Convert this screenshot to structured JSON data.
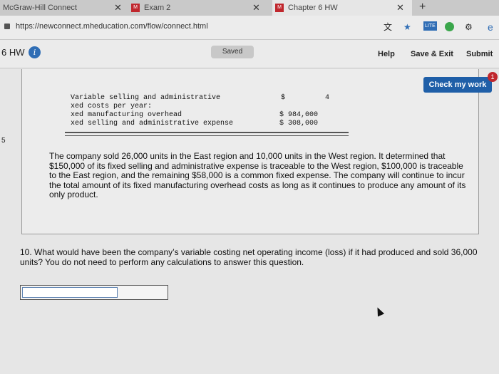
{
  "browser": {
    "tabs": [
      {
        "label": "McGraw-Hill Connect",
        "close": "✕"
      },
      {
        "label": "Exam 2",
        "close": "✕",
        "favicon": "M"
      },
      {
        "label": "Chapter 6 HW",
        "close": "✕",
        "favicon": "M"
      }
    ],
    "new_tab": "+",
    "url": "https://newconnect.mheducation.com/flow/connect.html",
    "ext_icons": [
      "translate-icon",
      "star-icon",
      "lite-icon",
      "circle-icon",
      "puzzle-icon",
      "menu-icon"
    ],
    "lite_label": "LITE"
  },
  "header": {
    "title": "6 HW",
    "info": "i",
    "saved": "Saved",
    "help": "Help",
    "save_exit": "Save & Exit",
    "submit": "Submit"
  },
  "check_work": {
    "label": "Check my work",
    "badge": "1"
  },
  "prev_table": {
    "rows": [
      {
        "label": "Variable selling and administrative",
        "sym": "$",
        "value": "4"
      },
      {
        "label": "xed costs per year:",
        "sym": "",
        "value": ""
      },
      {
        "label": "xed manufacturing overhead",
        "sym": "",
        "value": "$ 984,000"
      },
      {
        "label": "xed selling and administrative expense",
        "sym": "",
        "value": "$ 308,000"
      }
    ]
  },
  "left_marker": "5",
  "paragraph": "The company sold 26,000 units in the East region and 10,000 units in the West region. It determined that $150,000 of its fixed selling and administrative expense is traceable to the West region, $100,000 is traceable to the East region, and the remaining $58,000 is a common fixed expense. The company will continue to incur the total amount of its fixed manufacturing overhead costs as long as it continues to produce any amount of its only product.",
  "question": "10. What would have been the company’s variable costing net operating income (loss) if it had produced and sold 36,000 units? You do not need to perform any calculations to answer this question.",
  "colors": {
    "accent": "#1f5fa8",
    "brand": "#c0272d"
  }
}
